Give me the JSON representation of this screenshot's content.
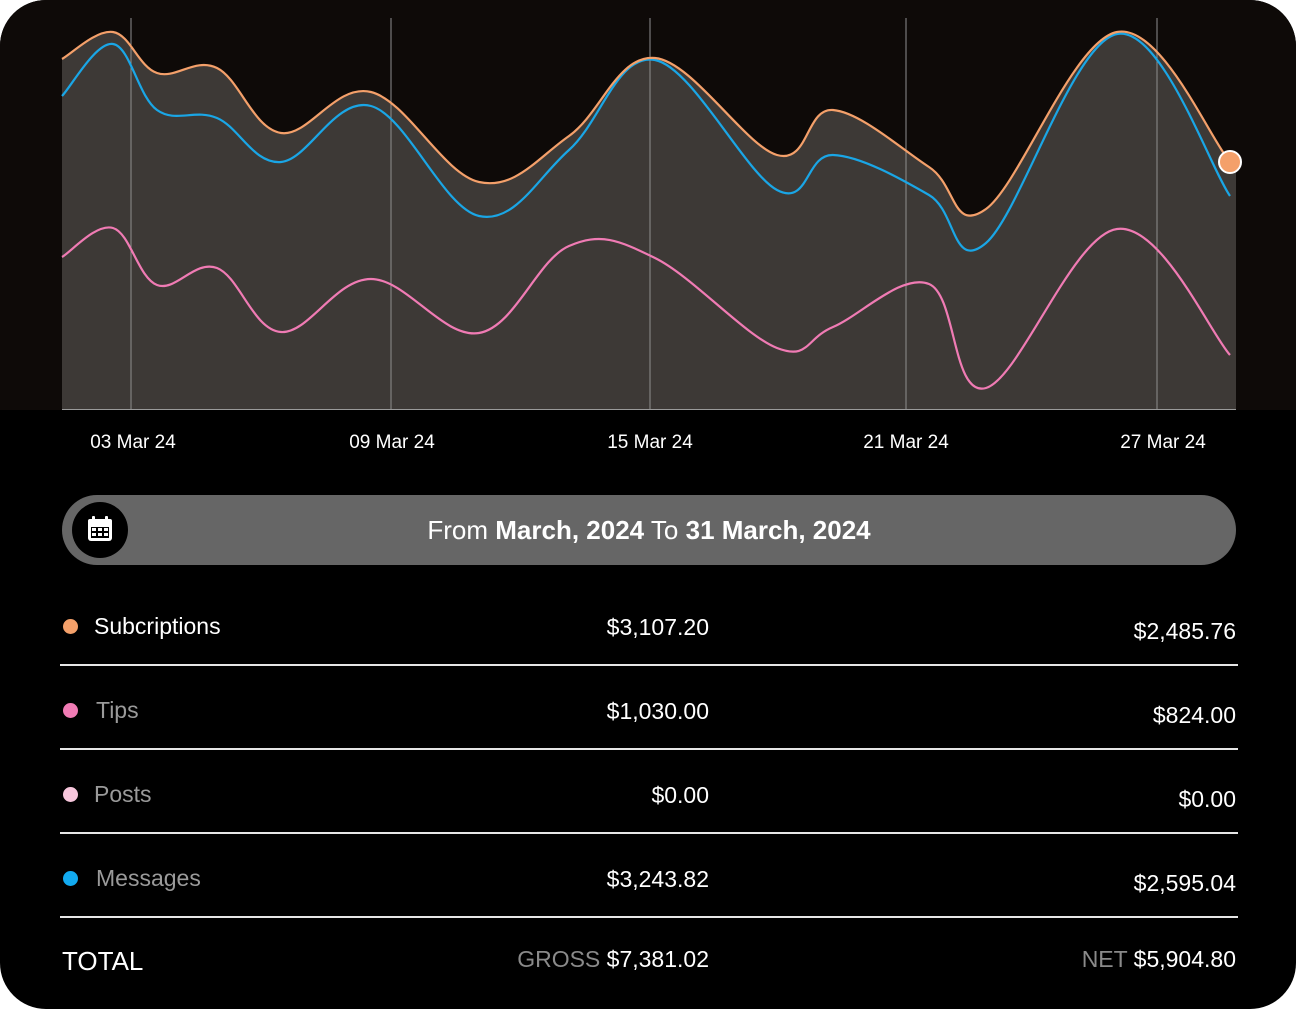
{
  "chart_data": {
    "type": "area",
    "x_tick_labels": [
      "03 Mar 24",
      "09 Mar 24",
      "15 Mar 24",
      "21 Mar 24",
      "27 Mar 24"
    ],
    "series": [
      {
        "key": "subscriptions",
        "color": "#f4a06a",
        "filled": true,
        "values": [
          59,
          32,
          73,
          68,
          133,
          92,
          182,
          136,
          58,
          155,
          110,
          167,
          209,
          32,
          162
        ]
      },
      {
        "key": "messages",
        "color": "#1aa6e6",
        "values": [
          96,
          44,
          110,
          118,
          162,
          106,
          216,
          150,
          60,
          190,
          155,
          195,
          243,
          34,
          196
        ]
      },
      {
        "key": "tips",
        "color": "#f07bb4",
        "values": [
          257,
          228,
          285,
          268,
          332,
          279,
          333,
          246,
          258,
          348,
          327,
          284,
          388,
          229,
          355
        ]
      }
    ],
    "end_marker_color": "#f4a06a"
  },
  "date_range": {
    "from_label": "From",
    "from_value": "March, 2024",
    "to_label": "To",
    "to_value": "31 March, 2024"
  },
  "rows": [
    {
      "label": "Subcriptions",
      "gross": "$3,107.20",
      "net": "$2,485.76",
      "dot_color": "#f4a06a",
      "label_color": "#ffffff"
    },
    {
      "label": "Tips",
      "gross": "$1,030.00",
      "net": "$824.00",
      "dot_color": "#f07bb4",
      "label_color": "#9a9a9a"
    },
    {
      "label": "Posts",
      "gross": "$0.00",
      "net": "$0.00",
      "dot_color": "#f7c6dc",
      "label_color": "#9a9a9a"
    },
    {
      "label": "Messages",
      "gross": "$3,243.82",
      "net": "$2,595.04",
      "dot_color": "#12aaf0",
      "label_color": "#9a9a9a"
    }
  ],
  "total": {
    "label": "TOTAL",
    "gross_label": "GROSS",
    "gross_value": "$7,381.02",
    "net_label": "NET",
    "net_value": "$5,904.80"
  }
}
